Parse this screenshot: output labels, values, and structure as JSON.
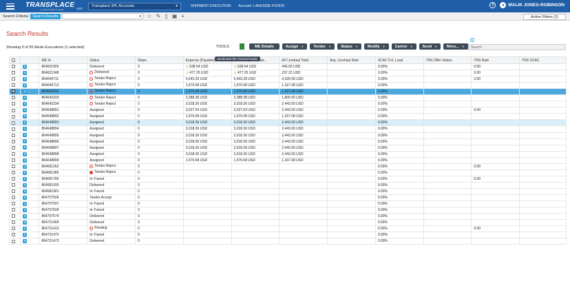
{
  "app": {
    "logo": "TRANSPLACE",
    "logo_sub": "an Uber Freight company",
    "env": "UAT",
    "account_select": "Transplace 3PL Accounts",
    "breadcrumb_section": "SHIPMENT EXECUTION",
    "breadcrumb_account": "Account: LAKESIDE FOODS",
    "user_name": "MALIK JONES-ROBINSON"
  },
  "subbar": {
    "criteria_label": "Search Criteria:",
    "criteria_value": "Search Results",
    "active_filters": "Active Filters (2)"
  },
  "page": {
    "title": "Search Results",
    "showing": "Showing 0 of 55 Mode Executions (1 selected)",
    "search_placeholder": "Search"
  },
  "tools": {
    "label": "TOOLS:",
    "buttons": [
      "ME Details",
      "Assign",
      "Tender",
      "Status",
      "Modify",
      "Carrier",
      "Send",
      "More..."
    ],
    "tooltip": "Bookmark the checked loads"
  },
  "colors": {
    "topbar": "#1f5fa8",
    "selected_row": "#4aa8df",
    "title_red": "#c0392b",
    "tool_button": "#3d4a57",
    "bookmark_flag": "#2e8b3a"
  },
  "table": {
    "columns": [
      "",
      "",
      "ME Id",
      "Status",
      "Stops",
      "Expense (Payable)",
      "Revenue (Receivab...",
      "AP Linehaul Total",
      "Avg. Linehaul Rate",
      "SCAC Pct. Load",
      "TNS Offer Status",
      "TNS Rate",
      "TNS SCAC"
    ],
    "rows": [
      {
        "id": "864691900",
        "status": "Delivered",
        "icon": "",
        "stops": "0",
        "exp": "538.94 USD",
        "rev": "538.94 USD",
        "warn": true,
        "ap": "445.00 USD",
        "avg": "",
        "scac": "0.00%",
        "tns": "",
        "rate": "0.00",
        "tscac": "",
        "checked": false,
        "row": ""
      },
      {
        "id": "864621348",
        "status": "Delivered",
        "icon": "ring",
        "stops": "0",
        "exp": "477.25 USD",
        "rev": "477.25 USD",
        "warn": true,
        "ap": "237.22 USD",
        "avg": "",
        "scac": "0.00%",
        "tns": "",
        "rate": "0.00",
        "tscac": "",
        "checked": false,
        "row": ""
      },
      {
        "id": "864640711",
        "status": "Tender Reject",
        "icon": "ring",
        "stops": "0",
        "exp": "5,643.39 USD",
        "rev": "5,643.39 USD",
        "warn": false,
        "ap": "4,328.58 USD",
        "avg": "",
        "scac": "0.00%",
        "tns": "",
        "rate": "0.00",
        "tscac": "",
        "checked": false,
        "row": ""
      },
      {
        "id": "864640712",
        "status": "Tender Reject",
        "icon": "ring",
        "stops": "0",
        "exp": "1,570.08 USD",
        "rev": "1,570.08 USD",
        "warn": false,
        "ap": "1,167.08 USD",
        "avg": "",
        "scac": "0.00%",
        "tns": "",
        "rate": "",
        "tscac": "",
        "checked": false,
        "row": ""
      },
      {
        "id": "864642332",
        "status": "Tender Reject",
        "icon": "ring",
        "stops": "0",
        "exp": "1,570.08 USD",
        "rev": "1,570.08 USD",
        "warn": false,
        "ap": "1,167.08 USD",
        "avg": "",
        "scac": "0.00%",
        "tns": "",
        "rate": "",
        "tscac": "",
        "checked": true,
        "row": "sel"
      },
      {
        "id": "864642333",
        "status": "Tender Reject",
        "icon": "ring",
        "stops": "0",
        "exp": "2,388.38 USD",
        "rev": "2,388.38 USD",
        "warn": false,
        "ap": "1,800.00 USD",
        "avg": "",
        "scac": "0.00%",
        "tns": "",
        "rate": "",
        "tscac": "",
        "checked": false,
        "row": ""
      },
      {
        "id": "864642334",
        "status": "Tender Reject",
        "icon": "ring",
        "stops": "0",
        "exp": "3,018.36 USD",
        "rev": "3,018.36 USD",
        "warn": false,
        "ap": "2,443.00 USD",
        "avg": "",
        "scac": "0.00%",
        "tns": "",
        "rate": "",
        "tscac": "",
        "checked": false,
        "row": ""
      },
      {
        "id": "864648891",
        "status": "Assigned",
        "icon": "",
        "stops": "0",
        "exp": "3,027.64 USD",
        "rev": "3,027.64 USD",
        "warn": false,
        "ap": "2,443.00 USD",
        "avg": "",
        "scac": "0.00%",
        "tns": "",
        "rate": "0.00",
        "tscac": "",
        "checked": false,
        "row": ""
      },
      {
        "id": "864648892",
        "status": "Assigned",
        "icon": "",
        "stops": "0",
        "exp": "1,570.08 USD",
        "rev": "1,570.08 USD",
        "warn": false,
        "ap": "1,167.08 USD",
        "avg": "",
        "scac": "0.00%",
        "tns": "",
        "rate": "",
        "tscac": "",
        "checked": false,
        "row": ""
      },
      {
        "id": "864648893",
        "status": "Assigned",
        "icon": "",
        "stops": "0",
        "exp": "3,018.36 USD",
        "rev": "3,018.36 USD",
        "warn": false,
        "ap": "2,443.00 USD",
        "avg": "",
        "scac": "0.00%",
        "tns": "",
        "rate": "",
        "tscac": "",
        "checked": false,
        "row": "hov"
      },
      {
        "id": "864648894",
        "status": "Assigned",
        "icon": "",
        "stops": "0",
        "exp": "3,018.36 USD",
        "rev": "3,018.36 USD",
        "warn": false,
        "ap": "2,443.00 USD",
        "avg": "",
        "scac": "0.00%",
        "tns": "",
        "rate": "",
        "tscac": "",
        "checked": false,
        "row": ""
      },
      {
        "id": "864648895",
        "status": "Assigned",
        "icon": "",
        "stops": "0",
        "exp": "3,018.36 USD",
        "rev": "3,018.36 USD",
        "warn": false,
        "ap": "2,443.00 USD",
        "avg": "",
        "scac": "0.00%",
        "tns": "",
        "rate": "",
        "tscac": "",
        "checked": false,
        "row": ""
      },
      {
        "id": "864648896",
        "status": "Assigned",
        "icon": "",
        "stops": "0",
        "exp": "3,018.36 USD",
        "rev": "3,018.36 USD",
        "warn": false,
        "ap": "2,443.00 USD",
        "avg": "",
        "scac": "0.00%",
        "tns": "",
        "rate": "",
        "tscac": "",
        "checked": false,
        "row": ""
      },
      {
        "id": "864648897",
        "status": "Assigned",
        "icon": "",
        "stops": "0",
        "exp": "3,018.36 USD",
        "rev": "3,018.36 USD",
        "warn": false,
        "ap": "2,443.00 USD",
        "avg": "",
        "scac": "0.00%",
        "tns": "",
        "rate": "",
        "tscac": "",
        "checked": false,
        "row": ""
      },
      {
        "id": "864648898",
        "status": "Assigned",
        "icon": "",
        "stops": "0",
        "exp": "3,018.36 USD",
        "rev": "3,018.36 USD",
        "warn": false,
        "ap": "2,443.00 USD",
        "avg": "",
        "scac": "0.00%",
        "tns": "",
        "rate": "",
        "tscac": "",
        "checked": false,
        "row": ""
      },
      {
        "id": "864648899",
        "status": "Assigned",
        "icon": "",
        "stops": "0",
        "exp": "1,570.08 USD",
        "rev": "1,570.08 USD",
        "warn": false,
        "ap": "1,167.08 USD",
        "avg": "",
        "scac": "0.00%",
        "tns": "",
        "rate": "",
        "tscac": "",
        "checked": false,
        "row": ""
      },
      {
        "id": "864681262",
        "status": "Tender Reject",
        "icon": "ring",
        "stops": "0",
        "exp": "",
        "rev": "",
        "warn": false,
        "ap": "",
        "avg": "",
        "scac": "0.00%",
        "tns": "",
        "rate": "0.00",
        "tscac": "",
        "checked": false,
        "row": ""
      },
      {
        "id": "864681385",
        "status": "Tender Reject",
        "icon": "dot",
        "stops": "0",
        "exp": "",
        "rev": "",
        "warn": false,
        "ap": "",
        "avg": "",
        "scac": "0.00%",
        "tns": "",
        "rate": "",
        "tscac": "",
        "checked": false,
        "row": ""
      },
      {
        "id": "864681785",
        "status": "In-Transit",
        "icon": "",
        "stops": "0",
        "exp": "",
        "rev": "",
        "warn": false,
        "ap": "",
        "avg": "",
        "scac": "0.00%",
        "tns": "",
        "rate": "0.00",
        "tscac": "",
        "checked": false,
        "row": ""
      },
      {
        "id": "864681935",
        "status": "Delivered",
        "icon": "",
        "stops": "0",
        "exp": "",
        "rev": "",
        "warn": false,
        "ap": "",
        "avg": "",
        "scac": "0.00%",
        "tns": "",
        "rate": "",
        "tscac": "",
        "checked": false,
        "row": ""
      },
      {
        "id": "864681981",
        "status": "In-Transit",
        "icon": "",
        "stops": "0",
        "exp": "",
        "rev": "",
        "warn": false,
        "ap": "",
        "avg": "",
        "scac": "0.00%",
        "tns": "",
        "rate": "",
        "tscac": "",
        "checked": false,
        "row": ""
      },
      {
        "id": "864707506",
        "status": "Tender Accept",
        "icon": "",
        "stops": "0",
        "exp": "",
        "rev": "",
        "warn": false,
        "ap": "",
        "avg": "",
        "scac": "0.00%",
        "tns": "",
        "rate": "",
        "tscac": "",
        "checked": false,
        "row": ""
      },
      {
        "id": "864707507",
        "status": "In-Transit",
        "icon": "",
        "stops": "0",
        "exp": "",
        "rev": "",
        "warn": false,
        "ap": "",
        "avg": "",
        "scac": "0.00%",
        "tns": "",
        "rate": "",
        "tscac": "",
        "checked": false,
        "row": ""
      },
      {
        "id": "864707508",
        "status": "In-Transit",
        "icon": "",
        "stops": "0",
        "exp": "",
        "rev": "",
        "warn": false,
        "ap": "",
        "avg": "",
        "scac": "0.00%",
        "tns": "",
        "rate": "",
        "tscac": "",
        "checked": false,
        "row": ""
      },
      {
        "id": "864707574",
        "status": "Delivered",
        "icon": "",
        "stops": "0",
        "exp": "",
        "rev": "",
        "warn": false,
        "ap": "",
        "avg": "",
        "scac": "0.00%",
        "tns": "",
        "rate": "",
        "tscac": "",
        "checked": false,
        "row": ""
      },
      {
        "id": "864721409",
        "status": "Delivered",
        "icon": "",
        "stops": "0",
        "exp": "",
        "rev": "",
        "warn": false,
        "ap": "",
        "avg": "",
        "scac": "0.00%",
        "tns": "",
        "rate": "",
        "tscac": "",
        "checked": false,
        "row": ""
      },
      {
        "id": "864721415",
        "status": "Pending",
        "icon": "ring",
        "stops": "0",
        "exp": "",
        "rev": "",
        "warn": false,
        "ap": "",
        "avg": "",
        "scac": "0.00%",
        "tns": "",
        "rate": "0.00",
        "tscac": "",
        "checked": false,
        "row": ""
      },
      {
        "id": "864721472",
        "status": "In-Transit",
        "icon": "",
        "stops": "0",
        "exp": "",
        "rev": "",
        "warn": false,
        "ap": "",
        "avg": "",
        "scac": "0.00%",
        "tns": "",
        "rate": "",
        "tscac": "",
        "checked": false,
        "row": ""
      },
      {
        "id": "864721473",
        "status": "Delivered",
        "icon": "",
        "stops": "0",
        "exp": "",
        "rev": "",
        "warn": false,
        "ap": "",
        "avg": "",
        "scac": "0.00%",
        "tns": "",
        "rate": "",
        "tscac": "",
        "checked": false,
        "row": ""
      }
    ]
  }
}
